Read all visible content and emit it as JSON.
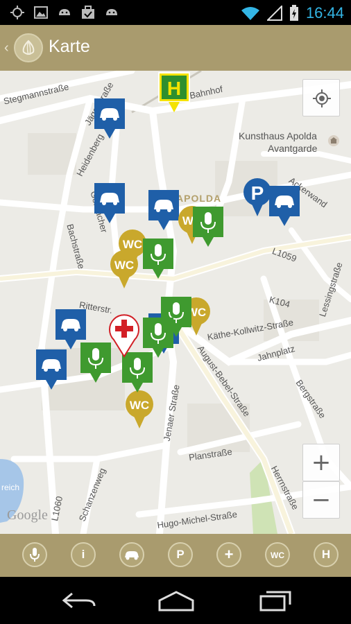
{
  "status_bar": {
    "time": "16:44",
    "left_icons": [
      "gps-icon",
      "image-icon",
      "android-icon",
      "briefcase-check-icon",
      "android-icon"
    ],
    "right_icons": [
      "wifi-icon",
      "signal-icon",
      "battery-charging-icon"
    ]
  },
  "action_bar": {
    "title": "Karte",
    "logo_icon": "onion-logo-icon",
    "up_icon": "caret-left-icon"
  },
  "map": {
    "streets": [
      "Stegmannstraße",
      "Jägerstraße",
      "Am Bahnhof",
      "Heidenberg",
      "Gerbacher",
      "Bachstraße",
      "Acker­wand",
      "L1059",
      "K104",
      "Lessingstraße",
      "Ritterstr.",
      "Käthe-Kollwitz-Straße",
      "Jahnplatz",
      "August-Bebel-Straße",
      "Bergstraße",
      "Jenaer Straße",
      "Planstraße",
      "Schanzenweg",
      "L1060",
      "Hugo-Michel-Straße",
      "Herrnstraße"
    ],
    "poi_label_1": "Kunsthaus Apolda",
    "poi_label_2": "Avantgarde",
    "town_label": "APOLDA",
    "lake_label": "reich",
    "attribution": "Google",
    "controls": {
      "my_location_icon": "crosshair-icon",
      "zoom_in": "+",
      "zoom_out": "−"
    },
    "markers": [
      {
        "type": "taxi",
        "icon": "car-icon"
      },
      {
        "type": "bus",
        "icon": "bus-stop-icon",
        "label": "H"
      },
      {
        "type": "taxi",
        "icon": "car-icon"
      },
      {
        "type": "taxi",
        "icon": "car-icon"
      },
      {
        "type": "parking",
        "icon": "parking-icon",
        "label": "P"
      },
      {
        "type": "taxi",
        "icon": "car-icon"
      },
      {
        "type": "audio",
        "icon": "microphone-icon"
      },
      {
        "type": "wc",
        "icon": "wc-icon",
        "label": "WC"
      },
      {
        "type": "audio",
        "icon": "microphone-icon"
      },
      {
        "type": "wc",
        "icon": "wc-icon",
        "label": "WC"
      },
      {
        "type": "audio",
        "icon": "microphone-icon"
      },
      {
        "type": "wc",
        "icon": "wc-icon",
        "label": "WC"
      },
      {
        "type": "taxi",
        "icon": "car-icon"
      },
      {
        "type": "pharmacy",
        "icon": "red-cross-icon"
      },
      {
        "type": "audio",
        "icon": "microphone-icon"
      },
      {
        "type": "taxi",
        "icon": "car-icon"
      },
      {
        "type": "audio",
        "icon": "microphone-icon"
      },
      {
        "type": "audio",
        "icon": "microphone-icon"
      },
      {
        "type": "wc",
        "icon": "wc-icon",
        "label": "WC"
      },
      {
        "type": "wc",
        "icon": "wc-icon",
        "label": "WC"
      }
    ]
  },
  "filter_bar": {
    "items": [
      {
        "name": "audio",
        "icon": "microphone-icon",
        "label": ""
      },
      {
        "name": "info",
        "icon": "info-icon",
        "label": "i"
      },
      {
        "name": "taxi",
        "icon": "car-icon",
        "label": ""
      },
      {
        "name": "parking",
        "icon": "parking-icon",
        "label": "P"
      },
      {
        "name": "pharmacy",
        "icon": "plus-icon",
        "label": "+"
      },
      {
        "name": "wc",
        "icon": "wc-icon",
        "label": "WC"
      },
      {
        "name": "bus",
        "icon": "bus-stop-icon",
        "label": "H"
      }
    ]
  },
  "nav_bar": {
    "buttons": [
      "back-icon",
      "home-icon",
      "recent-apps-icon"
    ]
  },
  "colors": {
    "action_bar": "#a99b6e",
    "taxi_marker": "#1f5fa8",
    "audio_marker": "#3f9a2f",
    "wc_marker": "#c9a82c",
    "bus_marker": "#f4e200",
    "time": "#33b5e5"
  }
}
